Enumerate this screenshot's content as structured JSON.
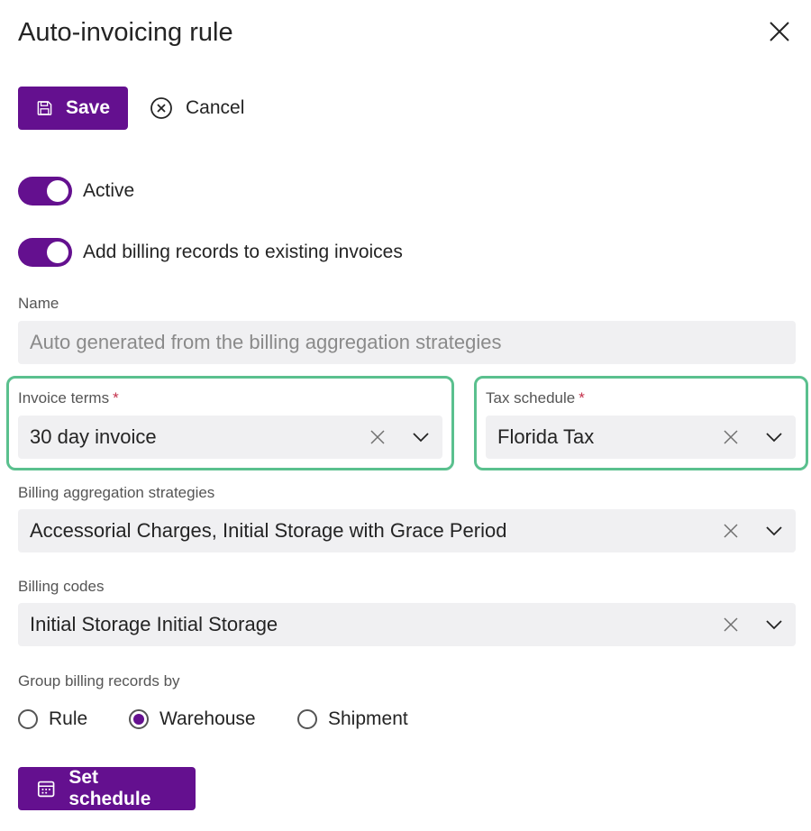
{
  "dialog": {
    "title": "Auto-invoicing rule"
  },
  "toolbar": {
    "save_label": "Save",
    "cancel_label": "Cancel"
  },
  "toggles": [
    {
      "label": "Active",
      "on": true
    },
    {
      "label": "Add billing records to existing invoices",
      "on": true
    }
  ],
  "fields": {
    "name": {
      "label": "Name",
      "placeholder": "Auto generated from the billing aggregation strategies"
    },
    "invoice_terms": {
      "label": "Invoice terms",
      "required_mark": "*",
      "value": "30 day invoice"
    },
    "tax_schedule": {
      "label": "Tax schedule",
      "required_mark": "*",
      "value": "Florida Tax"
    },
    "billing_aggregation": {
      "label": "Billing aggregation strategies",
      "value": "Accessorial Charges, Initial Storage with Grace Period"
    },
    "billing_codes": {
      "label": "Billing codes",
      "value": "Initial Storage Initial Storage"
    }
  },
  "group_by": {
    "label": "Group billing records by",
    "options": [
      "Rule",
      "Warehouse",
      "Shipment"
    ],
    "selected": "Warehouse"
  },
  "schedule_button": {
    "label": "Set schedule"
  },
  "colors": {
    "accent": "#64108f",
    "highlight": "#5ac08e",
    "field_bg": "#f0f0f2",
    "required": "#c4314b"
  }
}
